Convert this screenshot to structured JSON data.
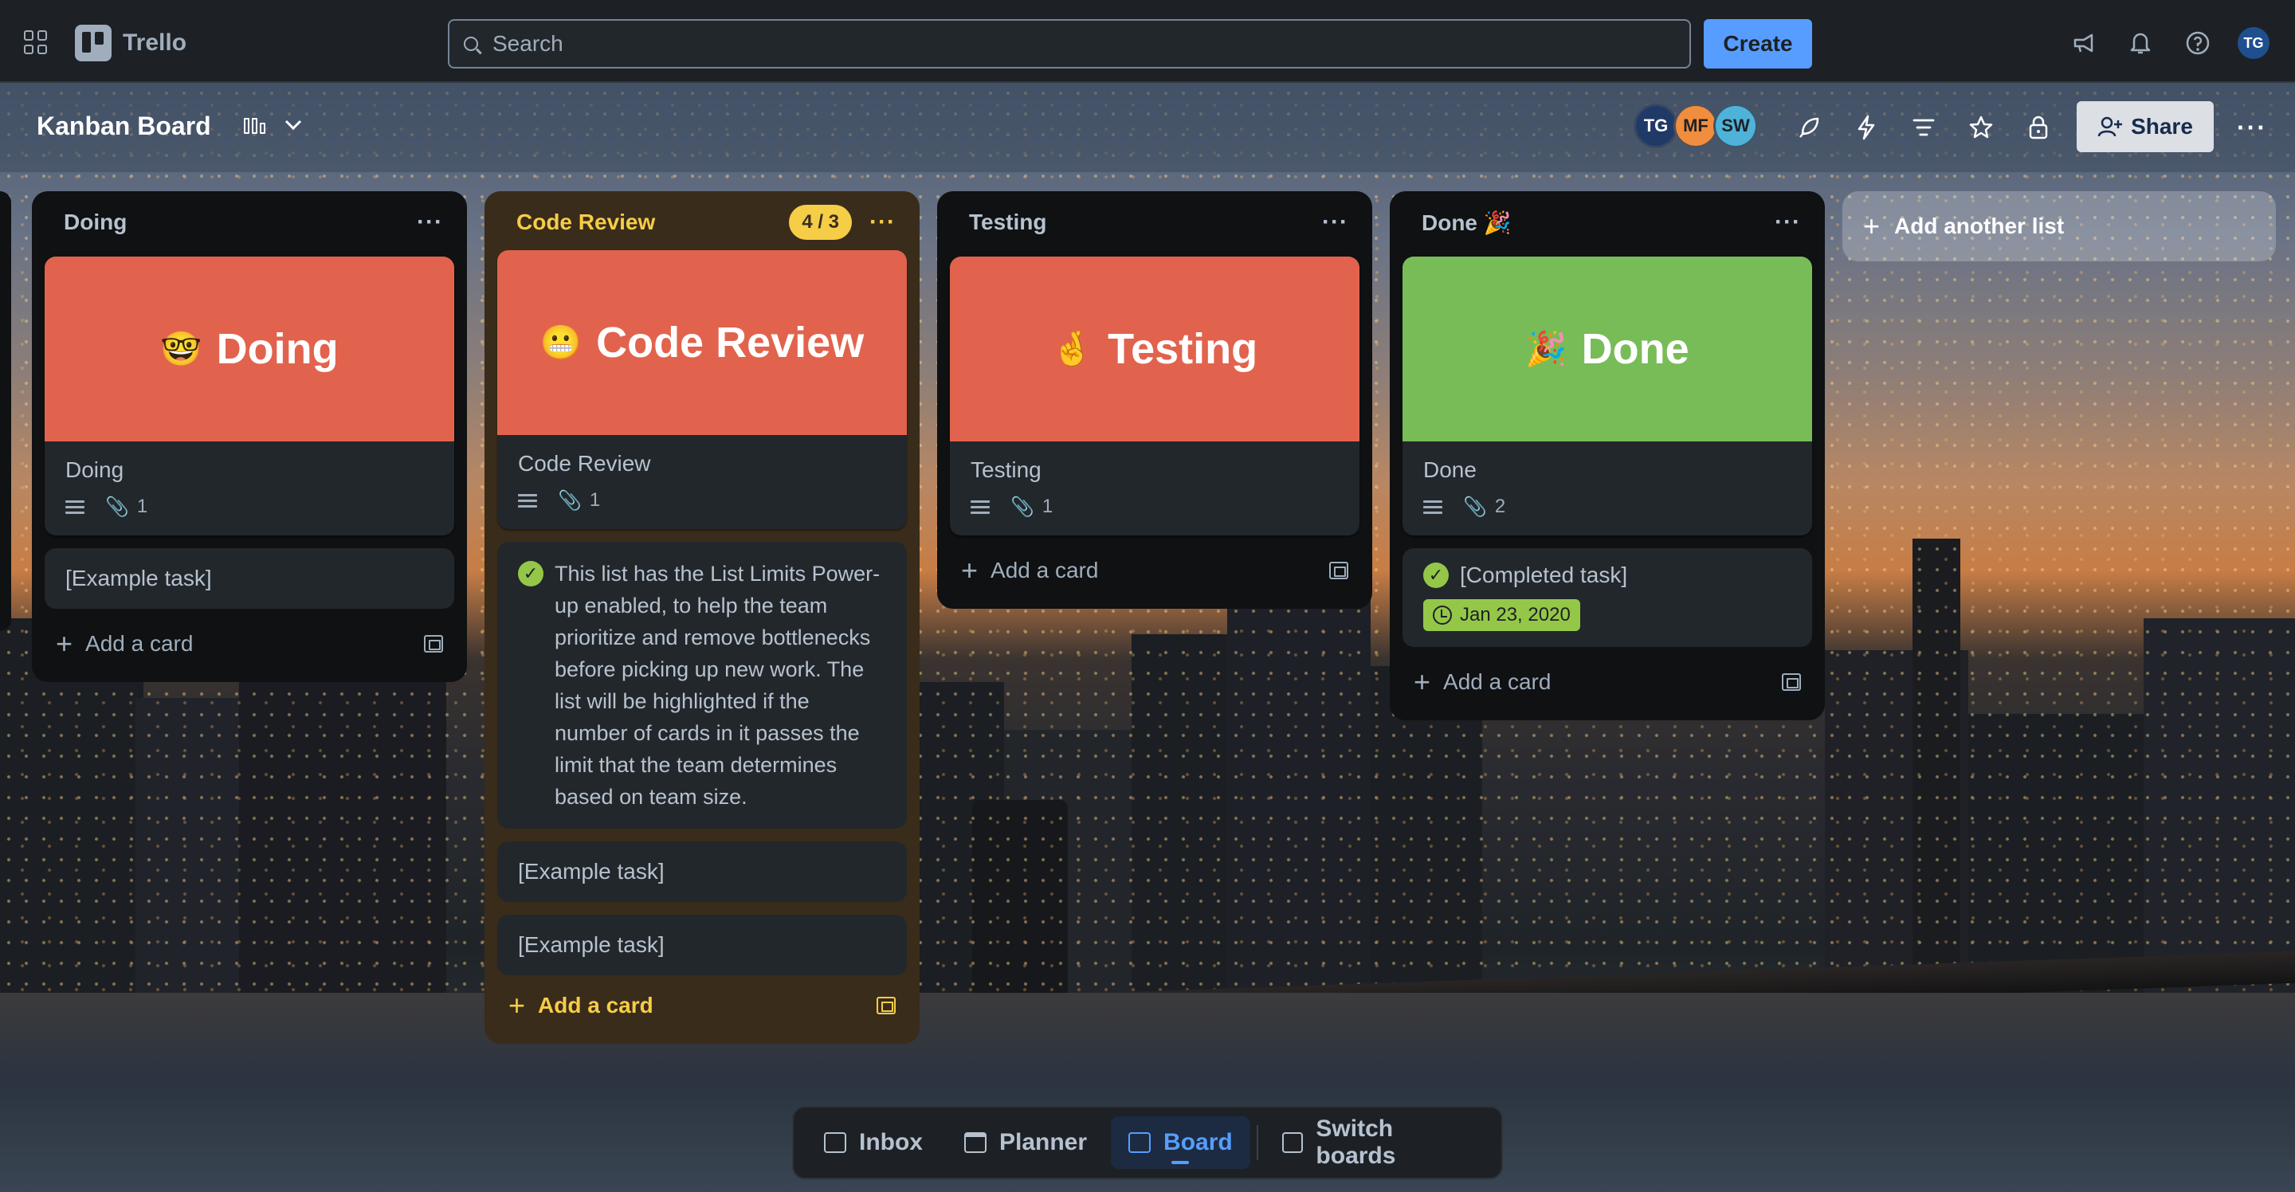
{
  "topnav": {
    "app_name": "Trello",
    "search_placeholder": "Search",
    "create_label": "Create",
    "user_initials": "TG"
  },
  "board": {
    "title": "Kanban Board",
    "members": [
      {
        "initials": "TG",
        "color": "#1f3a66"
      },
      {
        "initials": "MF",
        "color": "#f18d3f"
      },
      {
        "initials": "SW",
        "color": "#4fb3d9"
      }
    ],
    "share_label": "Share"
  },
  "lists": [
    {
      "title": "Doing",
      "cover_label": "Doing",
      "cover_emoji": "🤓",
      "card_title": "Doing",
      "attachments": "1",
      "extra_card": "[Example task]",
      "add_card": "Add a card"
    },
    {
      "title": "Code Review",
      "limit": "4 / 3",
      "cover_label": "Code Review",
      "cover_emoji": "😬",
      "card_title": "Code Review",
      "attachments": "1",
      "note": "This list has the List Limits Power-up enabled, to help the team prioritize and remove bottlenecks before picking up new work. The list will be highlighted if the number of cards in it passes the limit that the team determines based on team size.",
      "extra_cards": [
        "[Example task]",
        "[Example task]"
      ],
      "add_card": "Add a card"
    },
    {
      "title": "Testing",
      "cover_label": "Testing",
      "cover_emoji": "🤞",
      "card_title": "Testing",
      "attachments": "1",
      "add_card": "Add a card"
    },
    {
      "title": "Done 🎉",
      "cover_label": "Done",
      "cover_emoji": "🎉",
      "card_title": "Done",
      "attachments": "2",
      "completed_card": "[Completed task]",
      "due_date": "Jan 23, 2020",
      "add_card": "Add a card"
    }
  ],
  "add_list_label": "Add another list",
  "switcher": {
    "inbox": "Inbox",
    "planner": "Planner",
    "board": "Board",
    "switch_boards": "Switch boards"
  },
  "colors": {
    "accent": "#579dff",
    "cover_red": "#e2634d",
    "cover_green": "#78bc58",
    "limit_yellow": "#f5cd47"
  }
}
